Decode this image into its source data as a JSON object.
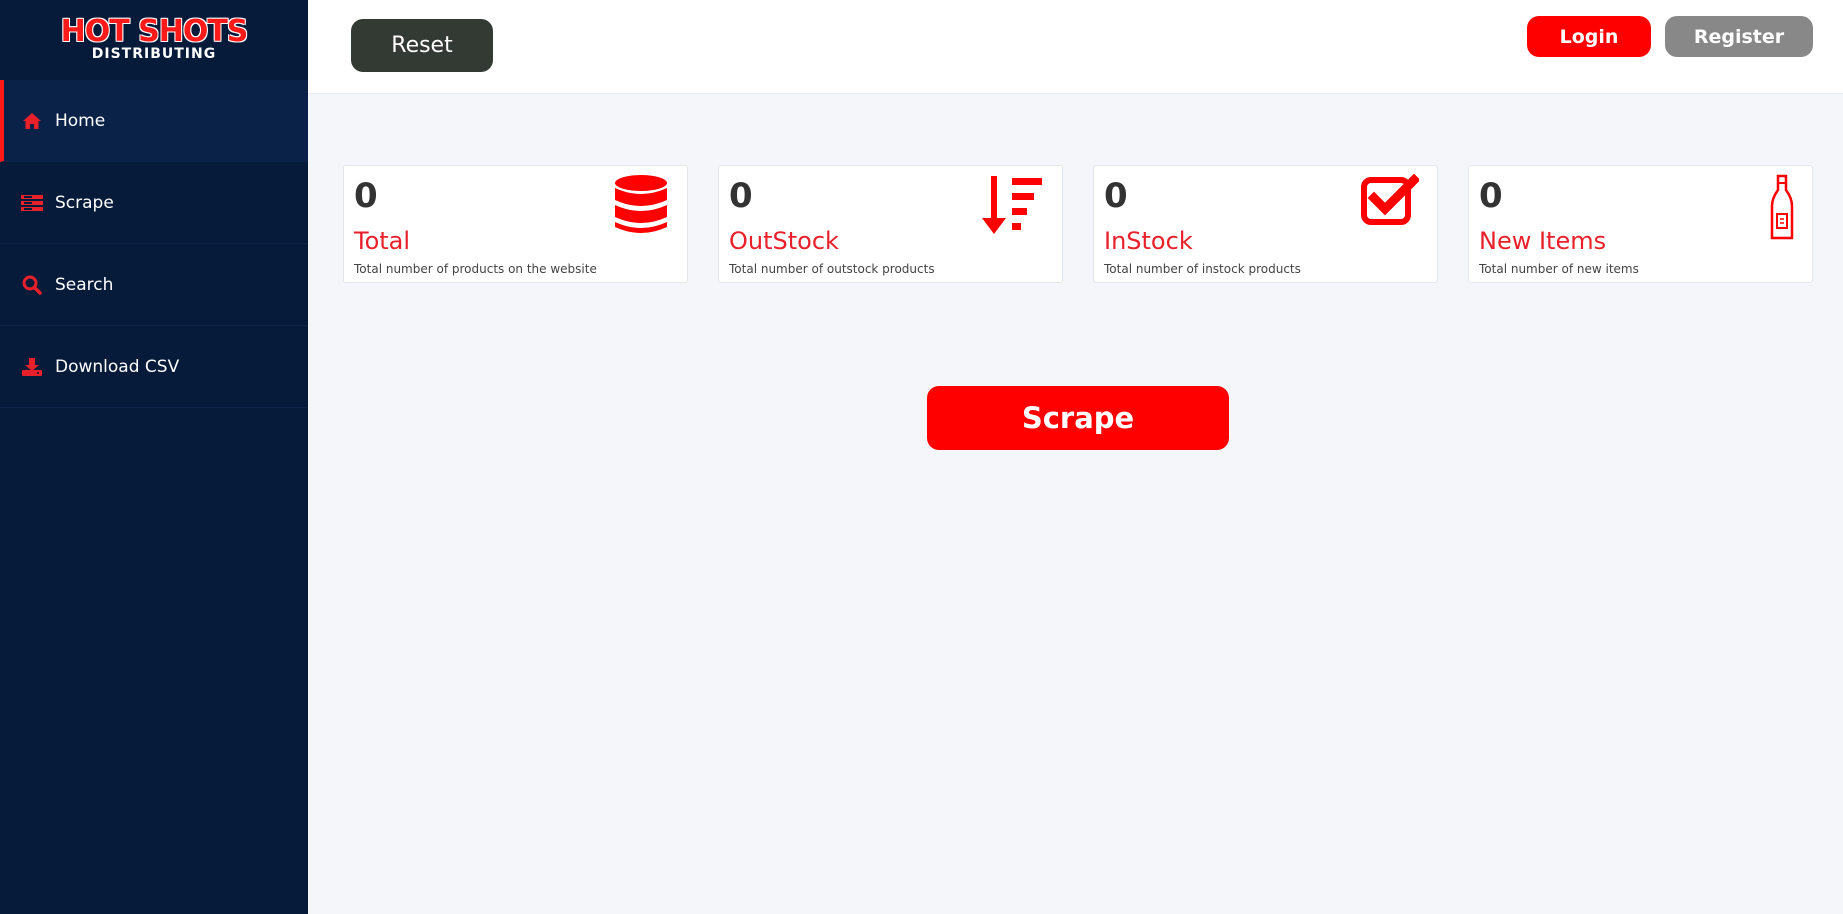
{
  "logo": {
    "line1": "HOT SHOTS",
    "line2": "DISTRIBUTING"
  },
  "sidebar": {
    "items": [
      {
        "label": "Home",
        "icon": "home-icon",
        "active": true
      },
      {
        "label": "Scrape",
        "icon": "server-icon",
        "active": false
      },
      {
        "label": "Search",
        "icon": "search-icon",
        "active": false
      },
      {
        "label": "Download CSV",
        "icon": "download-icon",
        "active": false
      }
    ]
  },
  "header": {
    "reset_label": "Reset",
    "login_label": "Login",
    "register_label": "Register"
  },
  "cards": [
    {
      "count": "0",
      "title": "Total",
      "desc": "Total number of products on the website",
      "icon": "database-icon"
    },
    {
      "count": "0",
      "title": "OutStock",
      "desc": "Total number of outstock products",
      "icon": "sort-amount-down-icon"
    },
    {
      "count": "0",
      "title": "InStock",
      "desc": "Total number of instock products",
      "icon": "check-square-icon"
    },
    {
      "count": "0",
      "title": "New Items",
      "desc": "Total number of new items",
      "icon": "bottle-icon"
    }
  ],
  "main": {
    "scrape_label": "Scrape"
  },
  "colors": {
    "accent": "#ff0000",
    "sidebar_bg": "#061a39",
    "reset_bg": "#333a33",
    "register_bg": "#888888",
    "page_bg": "#f4f6f9"
  }
}
